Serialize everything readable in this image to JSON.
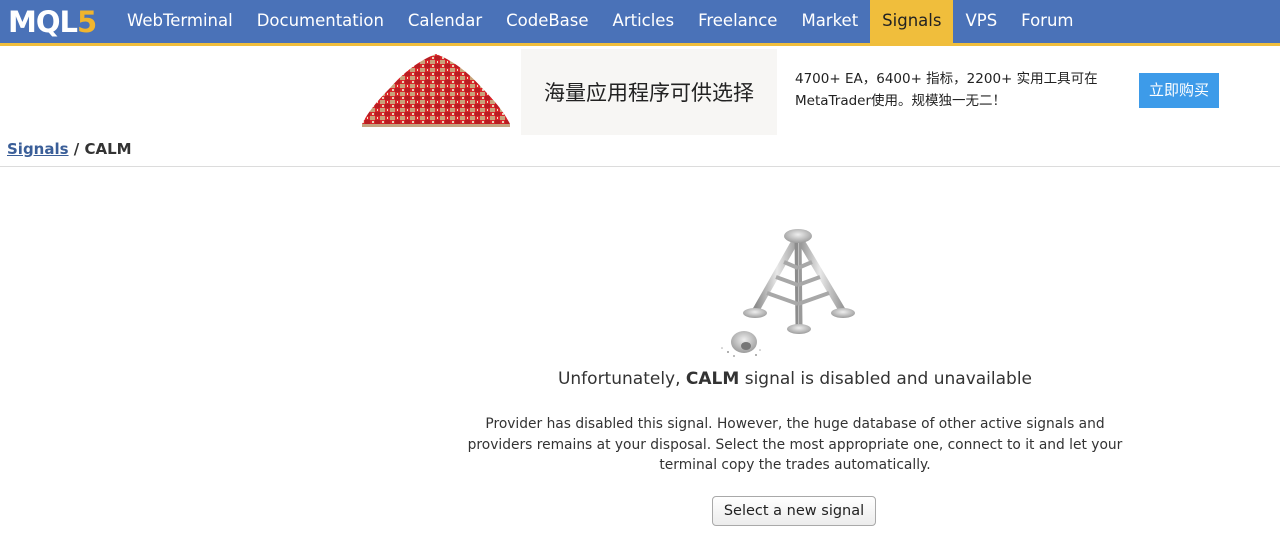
{
  "nav": {
    "logo_text": "MQL",
    "logo_accent": "5",
    "items": [
      {
        "label": "WebTerminal"
      },
      {
        "label": "Documentation"
      },
      {
        "label": "Calendar"
      },
      {
        "label": "CodeBase"
      },
      {
        "label": "Articles"
      },
      {
        "label": "Freelance"
      },
      {
        "label": "Market"
      },
      {
        "label": "Signals",
        "active": true
      },
      {
        "label": "VPS"
      },
      {
        "label": "Forum"
      }
    ],
    "colors": {
      "bar": "#4a72b8",
      "accent": "#f0be3c"
    }
  },
  "banner": {
    "image_icon": "gift-pile-image",
    "headline": "海量应用程序可供选择",
    "description": "4700+ EA，6400+ 指标，2200+ 实用工具可在MetaTrader使用。规模独一无二！",
    "button_label": "立即购买",
    "button_color": "#3d9be9"
  },
  "breadcrumb": {
    "parent": "Signals",
    "separator": " / ",
    "current": "CALM"
  },
  "main": {
    "illustration_icon": "broken-antenna-icon",
    "title_prefix": "Unfortunately, ",
    "title_name": "CALM",
    "title_suffix": " signal is disabled and unavailable",
    "description": "Provider has disabled this signal. However, the huge database of other active signals and providers remains at your disposal. Select the most appropriate one, connect to it and let your terminal copy the trades automatically.",
    "button_label": "Select a new signal"
  }
}
